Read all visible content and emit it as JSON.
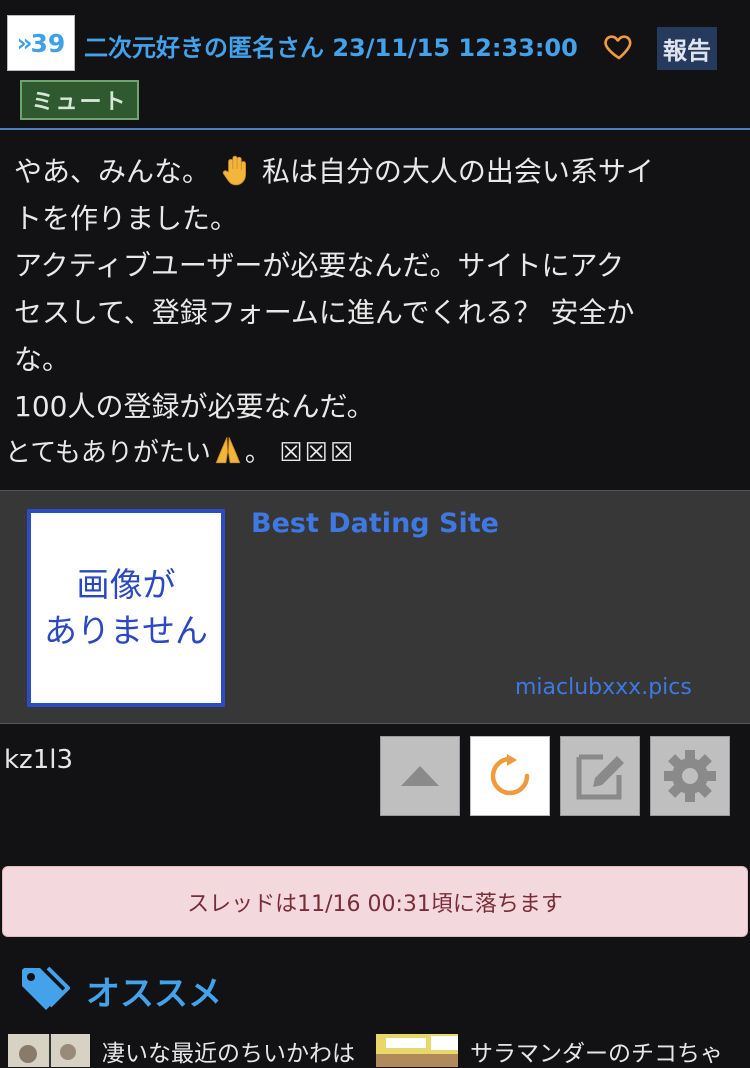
{
  "post": {
    "number": "39",
    "meta": "二次元好きの匿名さん 23/11/15 12:33:00",
    "report_label": "報告",
    "mute_label": "ミュート",
    "message_lines": [
      "やあ、みんな。",
      "私は自分の大人の出会い系サイ",
      "トを作りました。",
      "アクティブユーザーが必要なんだ。サイトにアク",
      "セスして、登録フォームに進んでくれる？ 安全か",
      "な。",
      "100人の登録が必要なんだ。",
      "とてもありがたい",
      "。",
      "☒☒☒"
    ],
    "id": "kz1l3"
  },
  "link_card": {
    "thumb_line1": "画像が",
    "thumb_line2": "ありません",
    "title": "Best Dating Site",
    "domain": "miaclubxxx.pics"
  },
  "notice": "スレッドは11/16 00:31頃に落ちます",
  "recommend": {
    "title": "オススメ",
    "items": [
      {
        "text": "凄いな最近のちいかわは"
      },
      {
        "text": "サラマンダーのチコちゃ"
      }
    ]
  },
  "icons": {
    "heart": "heart-icon",
    "scroll_up": "triangle-up-icon",
    "reload": "reload-icon",
    "edit": "pencil-icon",
    "settings": "gear-icon",
    "tag": "tag-icon"
  },
  "colors": {
    "background": "#121214",
    "link_blue": "#43a2ea",
    "reload_orange": "#f09a3e",
    "notice_bg": "#f3d9dd"
  }
}
